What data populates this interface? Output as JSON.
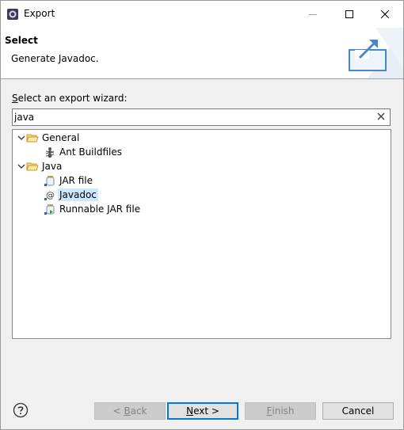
{
  "window": {
    "title": "Export",
    "icon": "eclipse-export-icon"
  },
  "header": {
    "title": "Select",
    "description": "Generate Javadoc."
  },
  "wizard": {
    "label_prefix": "S",
    "label_rest": "elect an export wizard:",
    "filter_value": "java"
  },
  "tree": {
    "groups": [
      {
        "label": "General",
        "children": [
          {
            "label": "Ant Buildfiles",
            "icon": "ant-icon"
          }
        ]
      },
      {
        "label": "Java",
        "children": [
          {
            "label": "JAR file",
            "icon": "jar-icon"
          },
          {
            "label": "Javadoc",
            "icon": "javadoc-icon",
            "selected": true
          },
          {
            "label": "Runnable JAR file",
            "icon": "runnable-jar-icon"
          }
        ]
      }
    ]
  },
  "buttons": {
    "back": {
      "prefix": "< ",
      "mnemonic": "B",
      "rest": "ack"
    },
    "next": {
      "mnemonic": "N",
      "rest": "ext >"
    },
    "finish": {
      "mnemonic": "F",
      "rest": "inish"
    },
    "cancel": "Cancel"
  }
}
